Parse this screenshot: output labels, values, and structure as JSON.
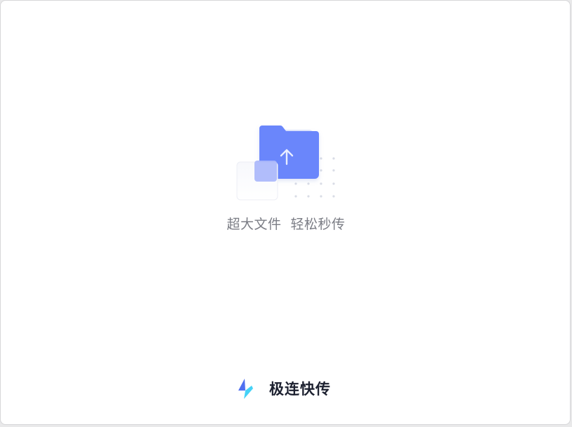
{
  "app": {
    "tagline": "超大文件  轻松秒传",
    "brand_name": "极连快传"
  },
  "icons": {
    "illustration": "folder-upload-icon",
    "upload_arrow": "arrow-up-icon",
    "logo": "lightning-bolt-logo-icon"
  },
  "colors": {
    "folder_primary": "#6b86fb",
    "folder_back": "#dfe5fb",
    "tagline_text": "#7b7d85",
    "brand_text": "#1d2130",
    "logo_dark": "#4f6ff0",
    "logo_light": "#45d2f7"
  }
}
